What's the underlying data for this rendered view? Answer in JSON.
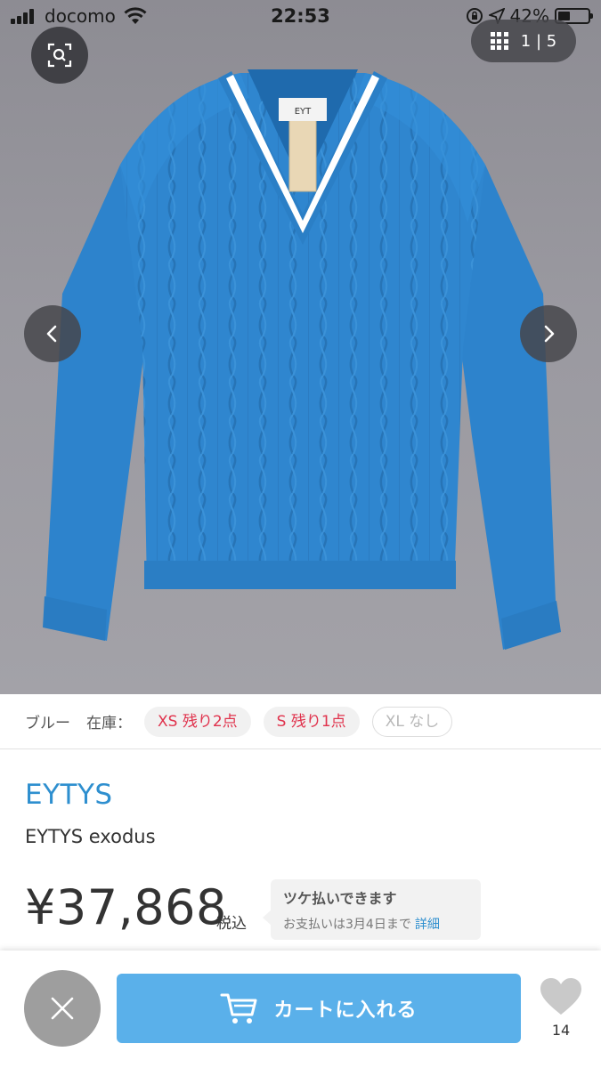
{
  "status_bar": {
    "carrier": "docomo",
    "time": "22:53",
    "battery_text": "42%",
    "battery_level": 0.42
  },
  "gallery": {
    "counter_current": "1",
    "counter_separator": "|",
    "counter_total": "5",
    "prev_icon": "chevron-left-icon",
    "next_icon": "chevron-right-icon",
    "lens_icon": "image-search-icon",
    "grid_icon": "grid-icon"
  },
  "stock": {
    "color": "ブルー",
    "label": "在庫：",
    "sizes": [
      {
        "text": "XS 残り2点",
        "status": "low"
      },
      {
        "text": "S 残り1点",
        "status": "low"
      },
      {
        "text": "XL なし",
        "status": "none"
      }
    ]
  },
  "product": {
    "brand": "EYTYS",
    "name": "EYTYS exodus",
    "price": "¥37,868",
    "tax_label": "税込"
  },
  "tsuke": {
    "title": "ツケ払いできます",
    "subtitle": "お支払いは3月4日まで",
    "detail_link": "詳細"
  },
  "bottom_bar": {
    "cart_label": "カートに入れる",
    "favorite_count": "14"
  },
  "colors": {
    "brand_blue": "#2e8fcf",
    "cart_button": "#5ab0ea",
    "low_stock_red": "#e0324c",
    "sweater_blue": "#2f86cf"
  }
}
